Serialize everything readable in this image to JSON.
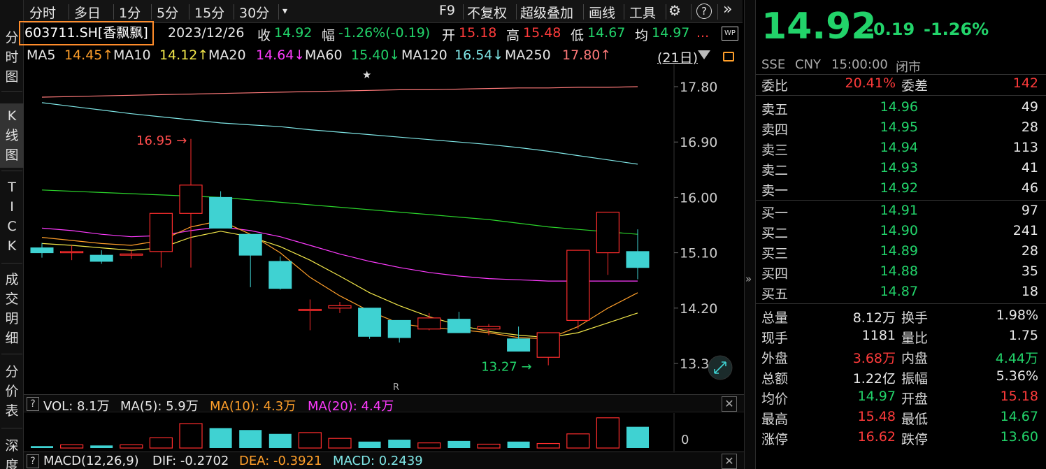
{
  "toolbar": {
    "items": [
      "分时",
      "多日",
      "1分",
      "5分",
      "15分",
      "30分"
    ],
    "dropdown": "▾",
    "right_items": [
      "F9",
      "不复权",
      "超级叠加",
      "画线",
      "工具"
    ],
    "gear": "⚙",
    "help": "?",
    "more": "»"
  },
  "left_tabs": [
    {
      "label": "分\n时\n图"
    },
    {
      "label": "K\n线\n图"
    },
    {
      "label": "T\nI\nC\nK"
    },
    {
      "label": "成\n交\n明\n细"
    },
    {
      "label": "分\n价\n表"
    },
    {
      "label": "深\n度"
    }
  ],
  "info": {
    "stock": "603711.SH[香飘飘]",
    "date": "2023/12/26",
    "close_label": "收",
    "close": "14.92",
    "range_label": "幅",
    "range": "-1.26%(-0.19)",
    "open_label": "开",
    "open": "15.18",
    "high_label": "高",
    "high": "15.48",
    "low_label": "低",
    "low": "14.67",
    "avg_label": "均",
    "avg": "14.97",
    "ellipsis": "...",
    "wp": "WP"
  },
  "ma_row": {
    "ma5_label": "MA5",
    "ma5": "14.45↑",
    "ma10_label": "MA10",
    "ma10": "14.12↑",
    "ma20_label": "MA20",
    "ma20": "14.64↓",
    "ma60_label": "MA60",
    "ma60": "15.40↓",
    "ma120_label": "MA120",
    "ma120": "16.54↓",
    "ma250_label": "MA250",
    "ma250": "17.80↑",
    "period": "(21日)"
  },
  "chart_data": {
    "type": "candlestick",
    "y_ticks": [
      "17.80",
      "16.90",
      "16.00",
      "15.10",
      "14.20",
      "13.30"
    ],
    "ylim": [
      13.3,
      17.8
    ],
    "annotations": {
      "high": "16.95",
      "low": "13.27",
      "star": "★",
      "r_marker": "R"
    },
    "candles": [
      {
        "o": 15.18,
        "c": 15.1,
        "h": 15.26,
        "l": 15.02
      },
      {
        "o": 15.1,
        "c": 15.12,
        "h": 15.22,
        "l": 14.98
      },
      {
        "o": 15.06,
        "c": 14.96,
        "h": 15.14,
        "l": 14.92
      },
      {
        "o": 15.06,
        "c": 15.08,
        "h": 15.14,
        "l": 15.0
      },
      {
        "o": 15.12,
        "c": 15.74,
        "h": 15.74,
        "l": 14.86
      },
      {
        "o": 15.74,
        "c": 16.2,
        "h": 16.95,
        "l": 14.86
      },
      {
        "o": 16.0,
        "c": 15.5,
        "h": 16.1,
        "l": 15.5
      },
      {
        "o": 15.4,
        "c": 15.06,
        "h": 15.4,
        "l": 14.54
      },
      {
        "o": 14.96,
        "c": 14.52,
        "h": 15.04,
        "l": 14.5
      },
      {
        "o": 14.16,
        "c": 14.18,
        "h": 14.34,
        "l": 13.84
      },
      {
        "o": 14.2,
        "c": 14.24,
        "h": 14.3,
        "l": 14.12
      },
      {
        "o": 14.2,
        "c": 13.74,
        "h": 14.2,
        "l": 13.7
      },
      {
        "o": 14.0,
        "c": 13.72,
        "h": 14.0,
        "l": 13.64
      },
      {
        "o": 13.86,
        "c": 14.04,
        "h": 14.12,
        "l": 13.84
      },
      {
        "o": 14.02,
        "c": 13.8,
        "h": 14.14,
        "l": 13.8
      },
      {
        "o": 13.86,
        "c": 13.9,
        "h": 13.94,
        "l": 13.76
      },
      {
        "o": 13.7,
        "c": 13.5,
        "h": 13.9,
        "l": 13.5
      },
      {
        "o": 13.4,
        "c": 13.8,
        "h": 13.8,
        "l": 13.27
      },
      {
        "o": 14.0,
        "c": 15.14,
        "h": 15.14,
        "l": 13.86
      },
      {
        "o": 15.1,
        "c": 15.76,
        "h": 15.76,
        "l": 14.74
      },
      {
        "o": 15.12,
        "c": 14.86,
        "h": 15.48,
        "l": 14.67
      }
    ],
    "ma_lines": {
      "ma5": [
        15.35,
        15.3,
        15.25,
        15.22,
        15.3,
        15.52,
        15.62,
        15.4,
        15.1,
        14.7,
        14.4,
        14.15,
        13.95,
        13.88,
        13.85,
        13.8,
        13.72,
        13.7,
        13.9,
        14.2,
        14.45
      ],
      "ma10": [
        15.25,
        15.22,
        15.18,
        15.14,
        15.18,
        15.35,
        15.45,
        15.36,
        15.2,
        14.98,
        14.72,
        14.45,
        14.24,
        14.06,
        13.92,
        13.82,
        13.76,
        13.72,
        13.8,
        13.96,
        14.12
      ],
      "ma20": [
        15.5,
        15.46,
        15.4,
        15.36,
        15.38,
        15.46,
        15.52,
        15.46,
        15.36,
        15.22,
        15.08,
        14.96,
        14.86,
        14.78,
        14.72,
        14.68,
        14.66,
        14.64,
        14.64,
        14.64,
        14.64
      ],
      "ma60": [
        16.12,
        16.1,
        16.08,
        16.06,
        16.04,
        16.02,
        16.0,
        15.96,
        15.92,
        15.88,
        15.84,
        15.8,
        15.76,
        15.72,
        15.68,
        15.64,
        15.58,
        15.52,
        15.48,
        15.44,
        15.4
      ],
      "ma120": [
        17.54,
        17.48,
        17.42,
        17.36,
        17.31,
        17.26,
        17.21,
        17.18,
        17.15,
        17.1,
        17.06,
        17.02,
        16.98,
        16.94,
        16.9,
        16.86,
        16.81,
        16.75,
        16.68,
        16.61,
        16.54
      ],
      "ma250": [
        17.63,
        17.64,
        17.65,
        17.66,
        17.67,
        17.68,
        17.69,
        17.7,
        17.71,
        17.72,
        17.73,
        17.74,
        17.75,
        17.75,
        17.76,
        17.77,
        17.78,
        17.78,
        17.79,
        17.79,
        17.8
      ]
    },
    "colors": {
      "up": "#ff2d2d",
      "down": "#3fd2d2",
      "ma5": "#ff9f2a",
      "ma10": "#f3e84a",
      "ma20": "#ff3bff",
      "ma60": "#2bd42b",
      "ma120": "#7fe6e6",
      "ma250": "#ff7a7a"
    }
  },
  "volume": {
    "q": "?",
    "label": "VOL: 8.1万",
    "ma5": "MA(5): 5.9万",
    "ma10": "MA(10): 4.3万",
    "ma20": "MA(20): 4.4万",
    "axis_zero": "0",
    "values": [
      0.3,
      0.5,
      0.4,
      0.5,
      1.6,
      3.8,
      3.1,
      2.8,
      2.2,
      2.4,
      1.5,
      1.0,
      1.3,
      0.8,
      1.1,
      0.6,
      1.0,
      0.7,
      2.2,
      4.7,
      3.3
    ]
  },
  "macd": {
    "q": "?",
    "label": "MACD(12,26,9)",
    "dif": "DIF: -0.2702",
    "dea": "DEA: -0.3921",
    "macd": "MACD: 0.2439"
  },
  "quote": {
    "price": "14.92",
    "change": "-0.19",
    "change_pct": "-1.26%",
    "exch": "SSE",
    "ccy": "CNY",
    "time": "15:00:00",
    "status": "闭市",
    "webi_label": "委比",
    "webi": "20.41%",
    "wecha_label": "委差",
    "wecha": "142",
    "asks": [
      {
        "label": "卖五",
        "price": "14.96",
        "vol": "49"
      },
      {
        "label": "卖四",
        "price": "14.95",
        "vol": "28"
      },
      {
        "label": "卖三",
        "price": "14.94",
        "vol": "113"
      },
      {
        "label": "卖二",
        "price": "14.93",
        "vol": "41"
      },
      {
        "label": "卖一",
        "price": "14.92",
        "vol": "46"
      }
    ],
    "bids": [
      {
        "label": "买一",
        "price": "14.91",
        "vol": "97"
      },
      {
        "label": "买二",
        "price": "14.90",
        "vol": "241"
      },
      {
        "label": "买三",
        "price": "14.89",
        "vol": "28"
      },
      {
        "label": "买四",
        "price": "14.88",
        "vol": "35"
      },
      {
        "label": "买五",
        "price": "14.87",
        "vol": "18"
      }
    ],
    "stats": [
      {
        "l1": "总量",
        "v1": "8.12万",
        "c1": "white",
        "l2": "换手",
        "v2": "1.98%",
        "c2": "white"
      },
      {
        "l1": "现手",
        "v1": "1181",
        "c1": "white",
        "l2": "量比",
        "v2": "1.75",
        "c2": "white"
      },
      {
        "l1": "外盘",
        "v1": "3.68万",
        "c1": "red",
        "l2": "内盘",
        "v2": "4.44万",
        "c2": "green"
      },
      {
        "l1": "总额",
        "v1": "1.22亿",
        "c1": "white",
        "l2": "振幅",
        "v2": "5.36%",
        "c2": "white"
      },
      {
        "l1": "均价",
        "v1": "14.97",
        "c1": "green",
        "l2": "开盘",
        "v2": "15.18",
        "c2": "red"
      },
      {
        "l1": "最高",
        "v1": "15.48",
        "c1": "red",
        "l2": "最低",
        "v2": "14.67",
        "c2": "green"
      },
      {
        "l1": "涨停",
        "v1": "16.62",
        "c1": "red",
        "l2": "跌停",
        "v2": "13.60",
        "c2": "green"
      }
    ]
  }
}
